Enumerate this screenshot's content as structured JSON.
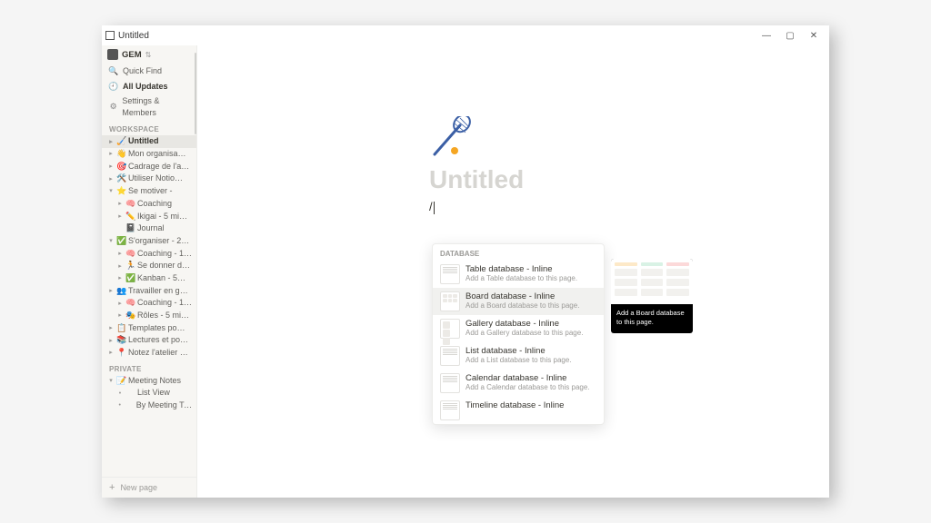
{
  "titlebar": {
    "app_title": "Untitled"
  },
  "window_controls": {
    "minimize": "—",
    "maximize": "▢",
    "close": "✕"
  },
  "workspace": {
    "name": "GEM"
  },
  "sidebar_nav": {
    "quick_find": "Quick Find",
    "all_updates": "All Updates",
    "settings": "Settings & Members"
  },
  "sections": {
    "workspace": "WORKSPACE",
    "private": "PRIVATE"
  },
  "workspace_tree": [
    {
      "depth": 1,
      "toggle": "▸",
      "emoji": "🏑",
      "label": "Untitled",
      "selected": true
    },
    {
      "depth": 1,
      "toggle": "▸",
      "emoji": "👋",
      "label": "Mon organisa…"
    },
    {
      "depth": 1,
      "toggle": "▸",
      "emoji": "🎯",
      "label": "Cadrage de l'a…"
    },
    {
      "depth": 1,
      "toggle": "▸",
      "emoji": "🛠️",
      "label": "Utiliser Notio…"
    },
    {
      "depth": 1,
      "toggle": "▾",
      "emoji": "⭐",
      "label": "Se motiver -"
    },
    {
      "depth": 2,
      "toggle": "▸",
      "emoji": "🧠",
      "label": "Coaching"
    },
    {
      "depth": 2,
      "toggle": "▸",
      "emoji": "✏️",
      "label": "Ikigai - 5 mi…"
    },
    {
      "depth": 2,
      "toggle": "",
      "emoji": "📓",
      "label": "Journal"
    },
    {
      "depth": 1,
      "toggle": "▾",
      "emoji": "✅",
      "label": "S'organiser - 2…"
    },
    {
      "depth": 2,
      "toggle": "▸",
      "emoji": "🧠",
      "label": "Coaching - 1…"
    },
    {
      "depth": 2,
      "toggle": "▸",
      "emoji": "🏃",
      "label": "Se donner d…"
    },
    {
      "depth": 2,
      "toggle": "▸",
      "emoji": "✅",
      "label": "Kanban - 5…"
    },
    {
      "depth": 1,
      "toggle": "▸",
      "emoji": "👥",
      "label": "Travailler en g…"
    },
    {
      "depth": 2,
      "toggle": "▸",
      "emoji": "🧠",
      "label": "Coaching - 1…"
    },
    {
      "depth": 2,
      "toggle": "▸",
      "emoji": "🎭",
      "label": "Rôles - 5 mi…"
    },
    {
      "depth": 1,
      "toggle": "▸",
      "emoji": "📋",
      "label": "Templates po…"
    },
    {
      "depth": 1,
      "toggle": "▸",
      "emoji": "📚",
      "label": "Lectures et po…"
    },
    {
      "depth": 1,
      "toggle": "▸",
      "emoji": "📍",
      "label": "Notez l'atelier …"
    }
  ],
  "private_tree": [
    {
      "depth": 1,
      "toggle": "▾",
      "emoji": "📝",
      "label": "Meeting Notes"
    },
    {
      "depth": 2,
      "toggle": "•",
      "emoji": "",
      "label": "List View"
    },
    {
      "depth": 2,
      "toggle": "•",
      "emoji": "",
      "label": "By Meeting Type"
    }
  ],
  "new_page": "New page",
  "page": {
    "title": "Untitled",
    "slash": "/"
  },
  "slash_menu": {
    "header": "DATABASE",
    "items": [
      {
        "title": "Table database - Inline",
        "desc": "Add a Table database to this page.",
        "kind": "tbl"
      },
      {
        "title": "Board database - Inline",
        "desc": "Add a Board database to this page.",
        "kind": "brd",
        "hi": true
      },
      {
        "title": "Gallery database - Inline",
        "desc": "Add a Gallery database to this page.",
        "kind": "gal"
      },
      {
        "title": "List database - Inline",
        "desc": "Add a List database to this page.",
        "kind": "tbl"
      },
      {
        "title": "Calendar database - Inline",
        "desc": "Add a Calendar database to this page.",
        "kind": "tbl"
      },
      {
        "title": "Timeline database - Inline",
        "desc": "",
        "kind": "tbl"
      }
    ]
  },
  "preview_tooltip": "Add a Board database to this page."
}
